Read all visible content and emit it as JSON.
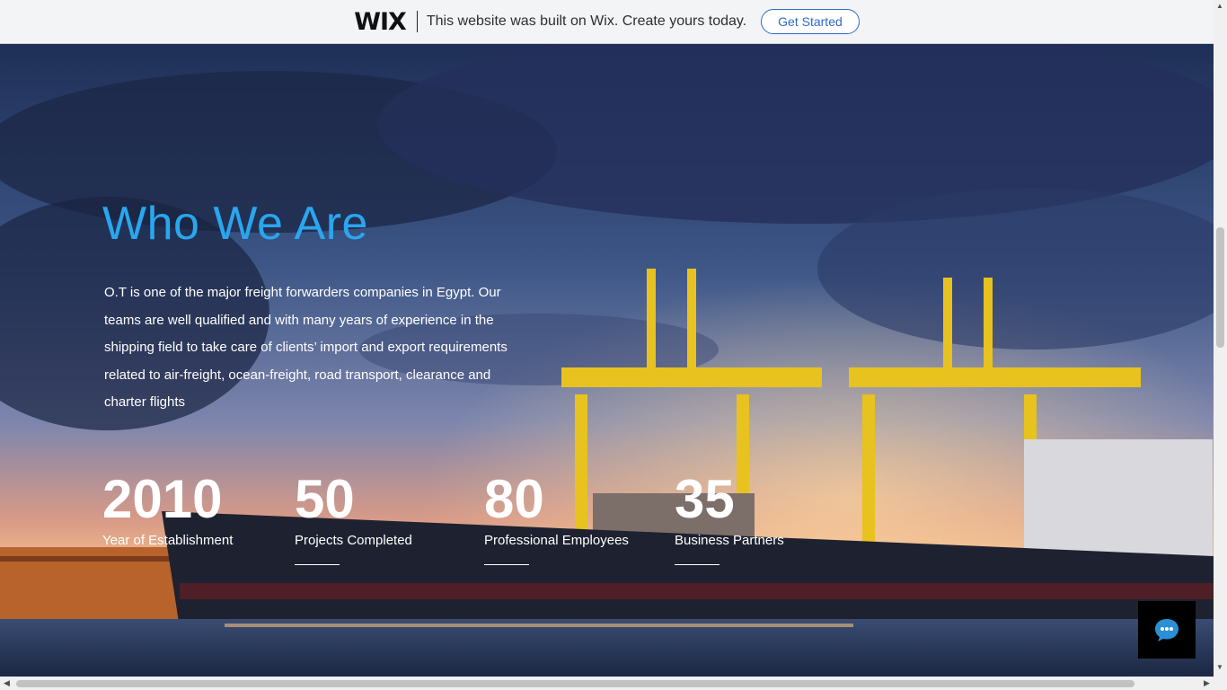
{
  "banner": {
    "logo": "WIX",
    "message": "This website was built on Wix. Create yours today.",
    "cta": "Get Started"
  },
  "hero": {
    "title": "Who We Are",
    "paragraph": "O.T is one of the major freight forwarders companies in Egypt. Our teams are well qualified and with many years of experience in the shipping field to take care of clients’ import and export requirements related to air-freight, ocean-freight, road transport, clearance and charter flights",
    "stats": [
      {
        "number": "2010",
        "label": "Year of Establishment"
      },
      {
        "number": "50",
        "label": "Projects Completed"
      },
      {
        "number": "80",
        "label": "Professional Employees"
      },
      {
        "number": "35",
        "label": "Business Partners"
      }
    ]
  },
  "widgets": {
    "chat_icon": "chat-bubble-icon"
  },
  "colors": {
    "title": "#2aa6ef",
    "banner_bg": "#f3f4f6",
    "cta": "#2f6ac9"
  }
}
